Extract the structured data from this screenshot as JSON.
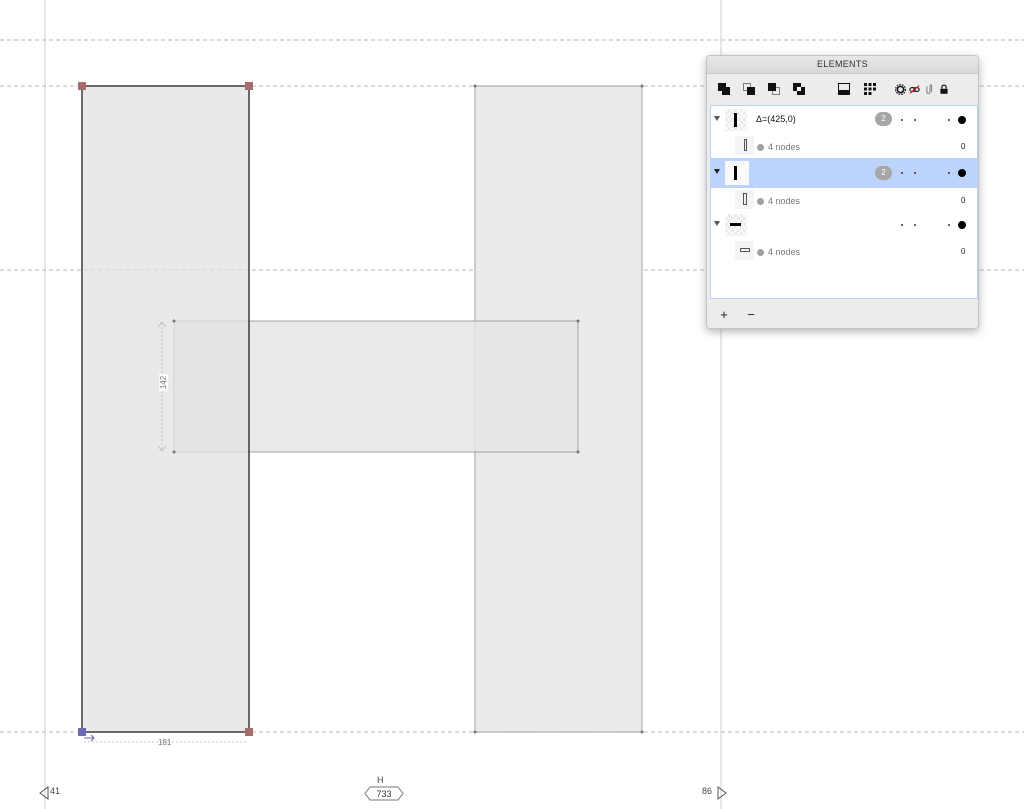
{
  "canvas": {
    "left_sidebearing": "41",
    "right_sidebearing": "86",
    "glyph_name": "H",
    "glyph_width": "733",
    "measure_width": "181",
    "measure_height": "142"
  },
  "panel": {
    "title": "ELEMENTS",
    "toolbar": {
      "icons": [
        "union-icon",
        "subtract-icon",
        "intersect-icon",
        "exclude-icon",
        "fill-mode-icon",
        "grid-icon",
        "gear-icon",
        "link-icon",
        "clip-icon",
        "lock-icon"
      ]
    },
    "layers": [
      {
        "name": "Δ=(425,0)",
        "badge": "2",
        "sub": "4 nodes",
        "sub_count": "0",
        "selected": false
      },
      {
        "name": "",
        "badge": "2",
        "sub": "4 nodes",
        "sub_count": "0",
        "selected": true
      },
      {
        "name": "",
        "badge": "",
        "sub": "4 nodes",
        "sub_count": "0",
        "selected": false
      }
    ],
    "add_label": "+",
    "remove_label": "−"
  },
  "colors": {
    "selection": "#bcd4fb",
    "shape_fill": "#ebebeb",
    "guide": "#b9b9b9"
  }
}
